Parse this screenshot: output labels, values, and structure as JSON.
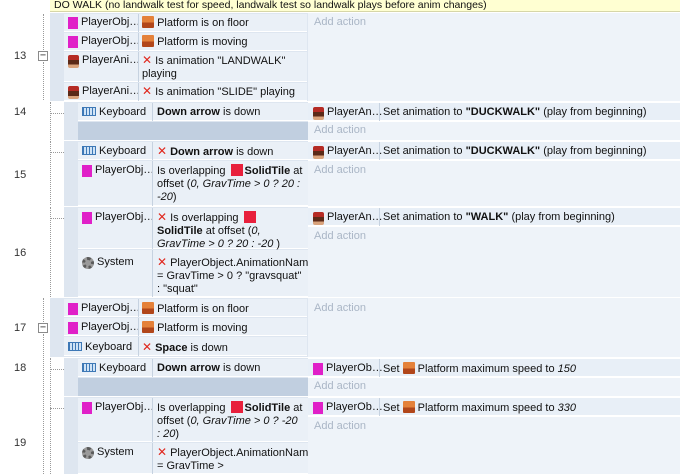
{
  "comment": "DO WALK (no landwalk test for speed, landwalk test so landwalk plays before anim changes)",
  "add_action": "Add action",
  "collapse_glyph": "−",
  "events": {
    "e13": {
      "number": "13",
      "c1": {
        "obj": "PlayerObj…",
        "text": "Platform is on floor"
      },
      "c2": {
        "obj": "PlayerObj…",
        "text": "Platform is moving"
      },
      "c3": {
        "obj": "PlayerAni…",
        "text": "Is animation \"LANDWALK\" playing"
      },
      "c4": {
        "obj": "PlayerAni…",
        "text": "Is animation \"SLIDE\" playing"
      }
    },
    "e14": {
      "number": "14",
      "c1": {
        "obj": "Keyboard",
        "bold": "Down arrow",
        "rest": " is down"
      },
      "a1": {
        "obj": "PlayerAn…",
        "pre": "Set animation to ",
        "bold": "\"DUCKWALK\"",
        "post": " (play from beginning)"
      }
    },
    "e15": {
      "number": "15",
      "c1": {
        "obj": "Keyboard",
        "bold": "Down arrow",
        "rest": " is down"
      },
      "c2": {
        "obj": "PlayerObj…",
        "pre": "Is overlapping ",
        "bold": "SolidTile",
        "mid": " at offset (",
        "italic": "0, GravTime > 0 ? 20 : -20",
        "post": ")"
      },
      "a1": {
        "obj": "PlayerAn…",
        "pre": "Set animation to ",
        "bold": "\"DUCKWALK\"",
        "post": " (play from beginning)"
      }
    },
    "e16": {
      "number": "16",
      "c1": {
        "obj": "PlayerObj…",
        "pre": "Is overlapping ",
        "bold": "SolidTile",
        "mid": " at offset (",
        "italic": "0, GravTime > 0 ? 20 : -20",
        "post": " )"
      },
      "c2": {
        "obj": "System",
        "text": "PlayerObject.AnimationName = GravTime > 0 ? \"gravsquat\" : \"squat\""
      },
      "a1": {
        "obj": "PlayerAn…",
        "pre": "Set animation to ",
        "bold": "\"WALK\"",
        "post": " (play from beginning)"
      }
    },
    "e17": {
      "number": "17",
      "c1": {
        "obj": "PlayerObj…",
        "text": "Platform is on floor"
      },
      "c2": {
        "obj": "PlayerObj…",
        "text": "Platform is moving"
      },
      "c3": {
        "obj": "Keyboard",
        "bold": "Space",
        "rest": " is down"
      }
    },
    "e18": {
      "number": "18",
      "c1": {
        "obj": "Keyboard",
        "bold": "Down arrow",
        "rest": " is down"
      },
      "a1": {
        "obj": "PlayerOb…",
        "pre": "Set ",
        "mid": " Platform maximum speed to ",
        "italic": "150"
      }
    },
    "e19": {
      "number": "19",
      "c1": {
        "obj": "PlayerObj…",
        "pre": "Is overlapping ",
        "bold": "SolidTile",
        "mid": " at offset (",
        "italic": "0, GravTime > 0 ? -20 : 20",
        "post": ")"
      },
      "c2": {
        "obj": "System",
        "text": "PlayerObject.AnimationName = GravTime >"
      },
      "a1": {
        "obj": "PlayerOb…",
        "pre": "Set ",
        "mid": " Platform maximum speed to ",
        "italic": "330"
      }
    }
  }
}
